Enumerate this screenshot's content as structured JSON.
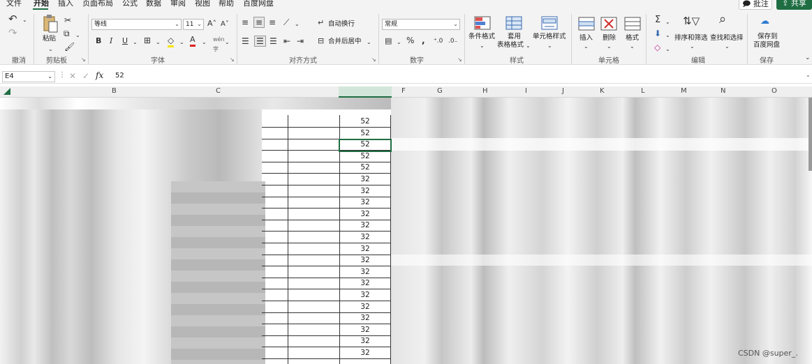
{
  "menu": {
    "items": [
      "文件",
      "开始",
      "插入",
      "页面布局",
      "公式",
      "数据",
      "审阅",
      "视图",
      "帮助",
      "百度网盘"
    ],
    "active": "开始"
  },
  "top_right": {
    "annotate_label": "批注",
    "share_label": "共享"
  },
  "ribbon": {
    "groups": {
      "undo": "撤消",
      "clipboard": "剪贴板",
      "font": "字体",
      "alignment": "对齐方式",
      "number": "数字",
      "styles": "样式",
      "cells": "单元格",
      "editing": "编辑",
      "save": "保存"
    },
    "paste_label": "粘贴",
    "font_name": "等线",
    "font_size": "11",
    "wrap_text": "自动换行",
    "merge_center": "合并后居中",
    "number_format": "常规",
    "cond_format": "条件格式",
    "table_format_1": "套用",
    "table_format_2": "表格格式",
    "cell_style": "单元格样式",
    "insert": "插入",
    "delete": "删除",
    "format": "格式",
    "sort_filter": "排序和筛选",
    "find_select": "查找和选择",
    "save_to_1": "保存到",
    "save_to_2": "百度网盘"
  },
  "formula_bar": {
    "name_box": "E4",
    "value": "52"
  },
  "columns": [
    "B",
    "C",
    "F",
    "G",
    "H",
    "I",
    "J",
    "K",
    "L",
    "M",
    "N",
    "O"
  ],
  "cells": [
    "52",
    "52",
    "52",
    "52",
    "52",
    "32",
    "32",
    "32",
    "32",
    "32",
    "32",
    "32",
    "32",
    "32",
    "32",
    "32",
    "32",
    "32",
    "32",
    "32",
    "32"
  ],
  "watermark": "CSDN @super_."
}
